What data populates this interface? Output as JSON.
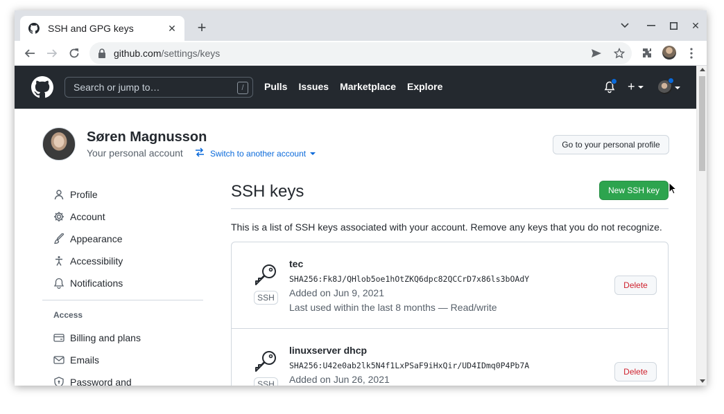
{
  "browser": {
    "tab_title": "SSH and GPG keys",
    "url_host": "github.com",
    "url_path": "/settings/keys"
  },
  "header": {
    "search_placeholder": "Search or jump to…",
    "search_shortcut": "/",
    "nav": [
      "Pulls",
      "Issues",
      "Marketplace",
      "Explore"
    ]
  },
  "account": {
    "name": "Søren Magnusson",
    "subtitle": "Your personal account",
    "switch_label": "Switch to another account",
    "profile_button": "Go to your personal profile"
  },
  "sidebar": {
    "items": [
      {
        "label": "Profile",
        "icon": "person-icon"
      },
      {
        "label": "Account",
        "icon": "gear-icon"
      },
      {
        "label": "Appearance",
        "icon": "paintbrush-icon"
      },
      {
        "label": "Accessibility",
        "icon": "accessibility-icon"
      },
      {
        "label": "Notifications",
        "icon": "bell-icon"
      }
    ],
    "access_heading": "Access",
    "access_items": [
      {
        "label": "Billing and plans",
        "icon": "credit-card-icon"
      },
      {
        "label": "Emails",
        "icon": "mail-icon"
      },
      {
        "label": "Password and",
        "icon": "shield-lock-icon"
      }
    ]
  },
  "main": {
    "title": "SSH keys",
    "new_key_button": "New SSH key",
    "description": "This is a list of SSH keys associated with your account. Remove any keys that you do not recognize.",
    "keys": [
      {
        "title": "tec",
        "fingerprint": "SHA256:Fk8J/QHlob5oe1hOtZKQ6dpc82QCCrD7x86ls3bOAdY",
        "added": "Added on Jun 9, 2021",
        "last_used": "Last used within the last 8 months — Read/write",
        "badge": "SSH",
        "delete_label": "Delete"
      },
      {
        "title": "linuxserver dhcp",
        "fingerprint": "SHA256:U42e0ab2lk5N4f1LxPSaF9iHxQir/UD4IDmq0P4Pb7A",
        "added": "Added on Jun 26, 2021",
        "last_used": "",
        "badge": "SSH",
        "delete_label": "Delete"
      }
    ]
  },
  "colors": {
    "header_bg": "#24292f",
    "primary_green": "#2da44e",
    "link_blue": "#0969da",
    "danger_red": "#cf222e"
  }
}
